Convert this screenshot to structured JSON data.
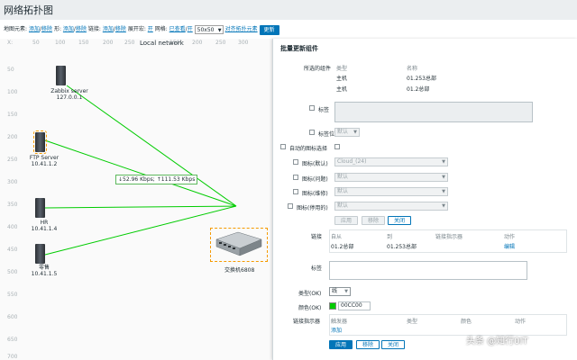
{
  "page": {
    "title": "网络拓扑图"
  },
  "toolbar": {
    "map_elements_label": "地图元素:",
    "add": "添加",
    "sep": "/",
    "remove": "移除",
    "shape_label": "形:",
    "link_label": "链接:",
    "expand_label": "展开宏:",
    "expand_value": "开",
    "grid_label": "网格:",
    "grid_shown": "已查看",
    "grid_on": "开",
    "grid_size": "50x50",
    "align_label": "对齐拓扑元素",
    "update": "更新"
  },
  "map": {
    "title": "Local network",
    "ruler_x": [
      "X: ",
      "50",
      "100",
      "150",
      "200",
      "250",
      "300"
    ],
    "ruler_y": [
      "50",
      "100",
      "150",
      "200",
      "250",
      "300",
      "350",
      "400",
      "450",
      "500",
      "550",
      "600",
      "650",
      "700"
    ],
    "link_traffic": "↓52.96 Kbps; ↑111.53 Kbps",
    "nodes": [
      {
        "name": "Zabbix server",
        "ip": "127.0.0.1"
      },
      {
        "name": "FTP Server",
        "ip": "10.41.1.2"
      },
      {
        "name": "HR",
        "ip": "10.41.1.4"
      },
      {
        "name": "零售",
        "ip": "10.41.1.5"
      }
    ],
    "switch_label": "交换机6808"
  },
  "panel": {
    "title": "批量更新组件",
    "selected_label": "所选的组件",
    "col_type": "类型",
    "col_name": "名称",
    "rows": [
      {
        "type": "主机",
        "name": "01.253总部"
      },
      {
        "type": "主机",
        "name": "01.2总部"
      }
    ],
    "label_label": "标签",
    "label_position_label": "标签位置",
    "label_position_value": "默认",
    "auto_icon_label": "自动的图标选择",
    "icon_default_label": "图标(默认)",
    "icon_default_value": "Cloud_(24)",
    "icon_problem_label": "图标(问题)",
    "icon_problem_value": "默认",
    "icon_maintenance_label": "图标(维修)",
    "icon_maintenance_value": "默认",
    "icon_disabled_label": "图标(停用的)",
    "icon_disabled_value": "默认",
    "apply_small": "应用",
    "remove_small": "移除",
    "close_small": "关闭",
    "links_label": "链接",
    "links_col_from": "自从",
    "links_col_to": "到",
    "links_col_indicator": "链接指示器",
    "links_col_action": "动作",
    "link_row": {
      "from": "01.2总部",
      "to": "01.253总部",
      "action": "编辑"
    },
    "link_label_label": "标签",
    "type_ok_label": "类型(OK)",
    "type_ok_value": "线",
    "color_ok_label": "颜色(OK)",
    "color_ok_value": "00CC00",
    "indicator_label": "链接指示器",
    "ind_col_trigger": "触发器",
    "ind_col_type": "类型",
    "ind_col_color": "颜色",
    "ind_col_action": "动作",
    "ind_add": "添加",
    "apply": "应用",
    "remove": "移除",
    "close": "关闭"
  },
  "watermark": "头条 @知行0IT",
  "colors": {
    "accent": "#0275b8",
    "link_green": "#00cc00",
    "selection": "#f59a00"
  }
}
